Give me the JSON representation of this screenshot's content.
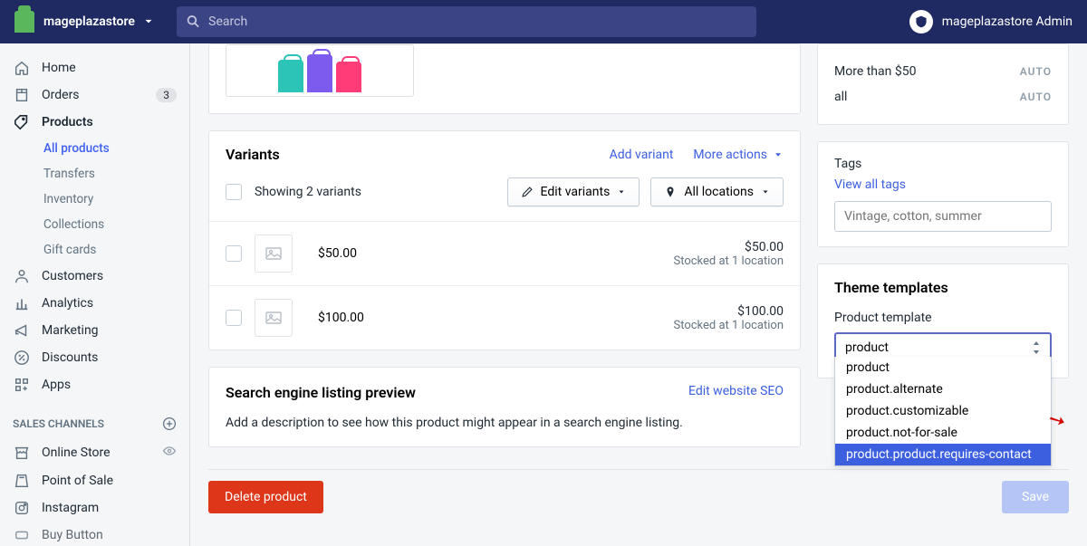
{
  "header": {
    "store_name": "mageplazastore",
    "search_placeholder": "Search",
    "admin_name": "mageplazastore Admin"
  },
  "sidebar": {
    "items": [
      {
        "label": "Home"
      },
      {
        "label": "Orders",
        "badge": "3"
      },
      {
        "label": "Products"
      },
      {
        "label": "Customers"
      },
      {
        "label": "Analytics"
      },
      {
        "label": "Marketing"
      },
      {
        "label": "Discounts"
      },
      {
        "label": "Apps"
      }
    ],
    "product_sub": [
      "All products",
      "Transfers",
      "Inventory",
      "Collections",
      "Gift cards"
    ],
    "channels_title": "SALES CHANNELS",
    "channels": [
      "Online Store",
      "Point of Sale",
      "Instagram",
      "Buy Button"
    ]
  },
  "variants": {
    "title": "Variants",
    "add_link": "Add variant",
    "more_link": "More actions",
    "showing": "Showing 2 variants",
    "edit_btn": "Edit variants",
    "location_btn": "All locations",
    "rows": [
      {
        "price_label": "$50.00",
        "price_right": "$50.00",
        "stock": "Stocked at 1 location"
      },
      {
        "price_label": "$100.00",
        "price_right": "$100.00",
        "stock": "Stocked at 1 location"
      }
    ]
  },
  "seo": {
    "title": "Search engine listing preview",
    "edit_link": "Edit website SEO",
    "desc": "Add a description to see how this product might appear in a search engine listing."
  },
  "footer": {
    "delete": "Delete product",
    "save": "Save"
  },
  "collections": {
    "row1": "More than $50",
    "row2": "all",
    "auto": "AUTO"
  },
  "tags": {
    "title": "Tags",
    "view_all": "View all tags",
    "placeholder": "Vintage, cotton, summer"
  },
  "templates": {
    "title": "Theme templates",
    "label": "Product template",
    "selected": "product",
    "options": [
      "product",
      "product.alternate",
      "product.customizable",
      "product.not-for-sale",
      "product.product.requires-contact"
    ]
  }
}
